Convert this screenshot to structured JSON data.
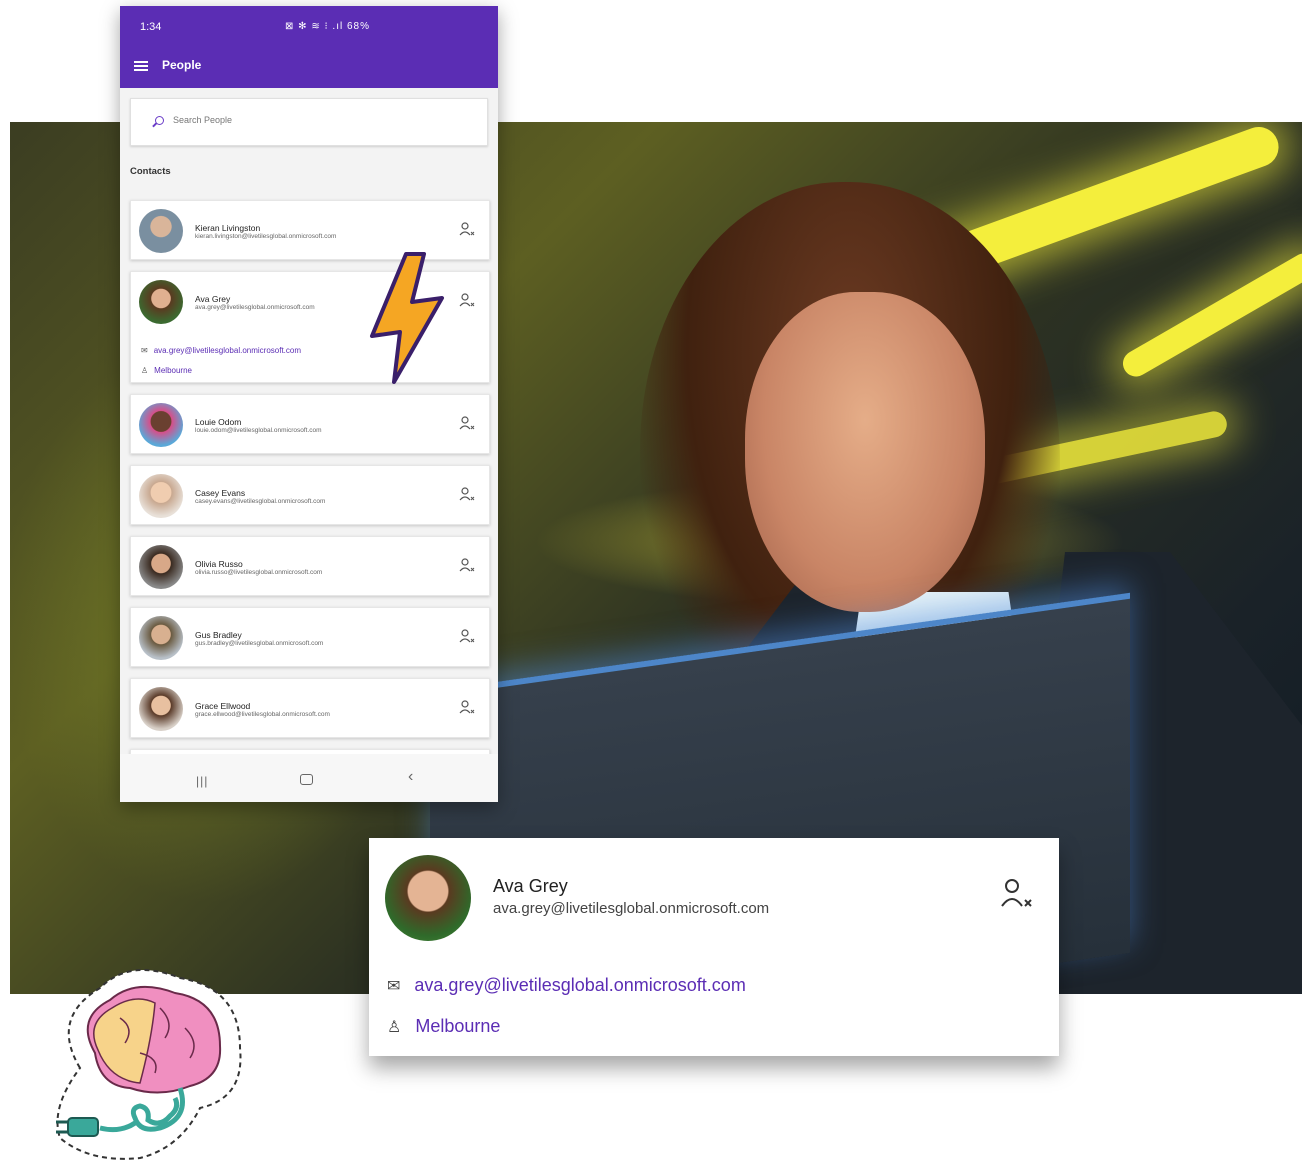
{
  "status_bar": {
    "time": "1:34",
    "icons_text": "⊠ ✻ ≋ ⁝ .ıl 68%"
  },
  "app_bar": {
    "title": "People"
  },
  "search": {
    "placeholder": "Search People"
  },
  "section": {
    "contacts_label": "Contacts"
  },
  "contacts": [
    {
      "name": "Kieran Livingston",
      "email": "kieran.livingston@livetilesglobal.onmicrosoft.com",
      "avatar_color": "#7a8fa0"
    },
    {
      "name": "Ava Grey",
      "email": "ava.grey@livetilesglobal.onmicrosoft.com",
      "avatar_color": "#8a6a40",
      "expanded": true,
      "detail_email": "ava.grey@livetilesglobal.onmicrosoft.com",
      "detail_location": "Melbourne"
    },
    {
      "name": "Louie Odom",
      "email": "louie.odom@livetilesglobal.onmicrosoft.com",
      "avatar_color": "#5a3a30"
    },
    {
      "name": "Casey Evans",
      "email": "casey.evans@livetilesglobal.onmicrosoft.com",
      "avatar_color": "#c8a890"
    },
    {
      "name": "Olivia Russo",
      "email": "olivia.russo@livetilesglobal.onmicrosoft.com",
      "avatar_color": "#6a5040"
    },
    {
      "name": "Gus Bradley",
      "email": "gus.bradley@livetilesglobal.onmicrosoft.com",
      "avatar_color": "#8a7a60"
    },
    {
      "name": "Grace Ellwood",
      "email": "grace.ellwood@livetilesglobal.onmicrosoft.com",
      "avatar_color": "#b09080"
    }
  ],
  "nav": {
    "recent": "|||",
    "back": "‹"
  },
  "callout": {
    "name": "Ava Grey",
    "email": "ava.grey@livetilesglobal.onmicrosoft.com",
    "detail_email": "ava.grey@livetilesglobal.onmicrosoft.com",
    "detail_location": "Melbourne"
  },
  "colors": {
    "brand": "#5b2db4",
    "link": "#5b2db4",
    "bolt": "#f5a623",
    "neon": "#f4ee3c"
  }
}
